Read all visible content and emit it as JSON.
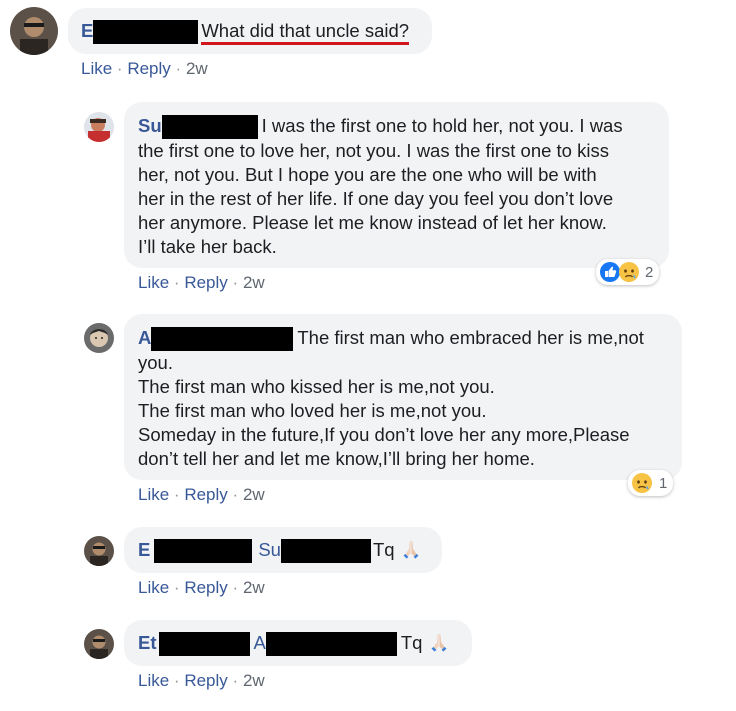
{
  "comments": [
    {
      "author_visible": "E",
      "text": "What did that uncle said?",
      "actions": {
        "like": "Like",
        "reply": "Reply",
        "time": "2w"
      }
    },
    {
      "author_visible": "Su",
      "lines": [
        "I was the first one to hold her, not you. I was",
        "the first one to love her, not you. I was the first one to kiss",
        "her, not you. But I hope you are the one who will be with",
        "her in the rest of her life. If one day you feel you don’t love",
        "her anymore. Please let me know instead of let her know.",
        "I’ll take her back."
      ],
      "reactions": {
        "count": "2",
        "icons": [
          "like-icon",
          "sad-icon"
        ]
      },
      "actions": {
        "like": "Like",
        "reply": "Reply",
        "time": "2w"
      }
    },
    {
      "author_visible": "A",
      "lines": [
        "The first man who embraced her is me,not",
        "you.",
        "The first man who kissed her is me,not you.",
        "The first man who loved her is me,not you.",
        "Someday in the future,If you don’t love her any more,Please",
        "don’t tell her and let me know,I’ll bring her home."
      ],
      "reactions": {
        "count": "1",
        "icons": [
          "sad-icon"
        ]
      },
      "actions": {
        "like": "Like",
        "reply": "Reply",
        "time": "2w"
      }
    },
    {
      "author_visible": "E",
      "mention_visible": "Su",
      "text": "Tq",
      "emoji": "praying-hands-icon",
      "actions": {
        "like": "Like",
        "reply": "Reply",
        "time": "2w"
      }
    },
    {
      "author_visible": "Et",
      "mention_visible": "A",
      "text": "Tq",
      "emoji": "praying-hands-icon",
      "actions": {
        "like": "Like",
        "reply": "Reply",
        "time": "2w"
      }
    }
  ],
  "separator": "·",
  "colors": {
    "bubble": "#f2f3f5",
    "name": "#385898",
    "link": "#385898",
    "underline": "#d0151b",
    "like_blue": "#1877f2",
    "sad_yellow": "#f7c344"
  }
}
